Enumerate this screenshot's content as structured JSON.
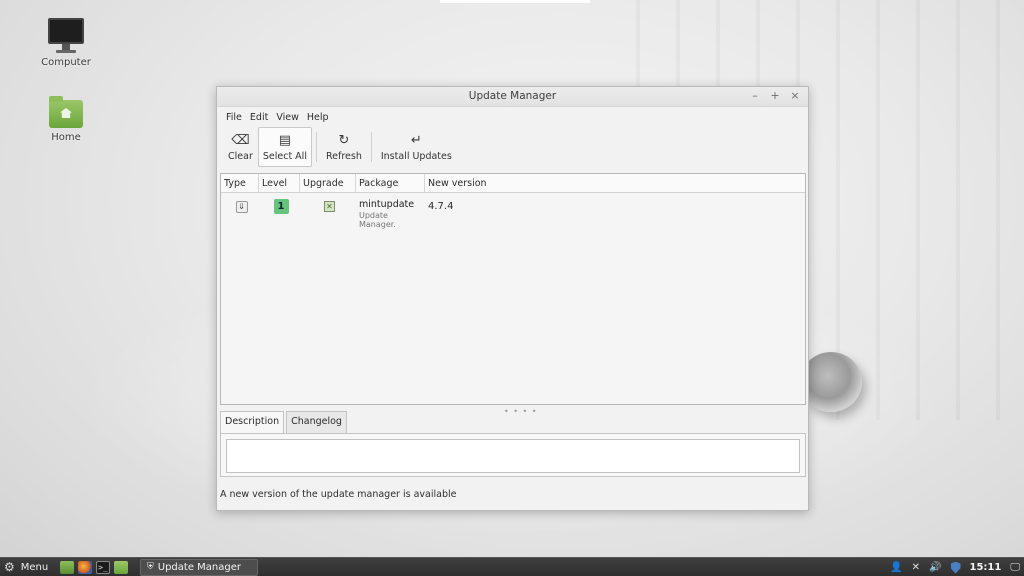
{
  "desktop": {
    "icons": [
      {
        "label": "Computer",
        "icon": "computer-icon"
      },
      {
        "label": "Home",
        "icon": "home-folder-icon"
      }
    ]
  },
  "window": {
    "title": "Update Manager",
    "controls": {
      "minimize": "–",
      "maximize": "+",
      "close": "×"
    },
    "menu": [
      "File",
      "Edit",
      "View",
      "Help"
    ],
    "toolbar": {
      "clear": {
        "label": "Clear",
        "glyph": "⌫",
        "icon": "clear-icon"
      },
      "select_all": {
        "label": "Select All",
        "glyph": "▤",
        "icon": "select-all-icon"
      },
      "refresh": {
        "label": "Refresh",
        "glyph": "↻",
        "icon": "refresh-icon"
      },
      "install": {
        "label": "Install Updates",
        "glyph": "↵",
        "icon": "install-icon"
      }
    },
    "columns": [
      "Type",
      "Level",
      "Upgrade",
      "Package",
      "New version"
    ],
    "updates": [
      {
        "type_glyph": "⇓",
        "level": "1",
        "level_color": "#63c57b",
        "upgrade_glyph": "✕",
        "package": "mintupdate",
        "description": "Update Manager.",
        "new_version": "4.7.4"
      }
    ],
    "tabs": {
      "description": "Description",
      "changelog": "Changelog",
      "active": "Description"
    },
    "status": "A new version of the update manager is available"
  },
  "taskbar": {
    "menu_label": "Menu",
    "launchers": [
      "show-desktop-icon",
      "firefox-icon",
      "terminal-icon",
      "files-icon"
    ],
    "terminal_glyph": ">_",
    "task_label": "Update Manager",
    "clock": "15:11",
    "tray_icons": [
      "user-icon",
      "network-icon",
      "volume-icon",
      "update-shield-icon",
      "display-icon"
    ]
  }
}
